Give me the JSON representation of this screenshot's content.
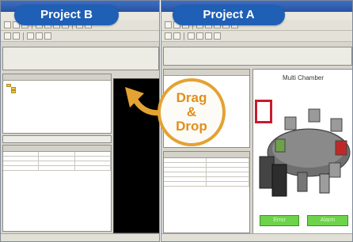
{
  "labels": {
    "project_b": "Project B",
    "project_a": "Project A"
  },
  "drag_drop": {
    "line1": "Drag",
    "line2": "&",
    "line3": "Drop"
  },
  "scene": {
    "title": "Multi Chamber",
    "button_left": "Error",
    "button_right": "Alarm"
  },
  "colors": {
    "pill_blue": "#1f5fb5",
    "arrow_orange": "#e3a233",
    "highlight_red": "#c61b2f",
    "button_green": "#6dd34a"
  },
  "icons": [
    "drag-arrow-icon",
    "folder-icon"
  ]
}
